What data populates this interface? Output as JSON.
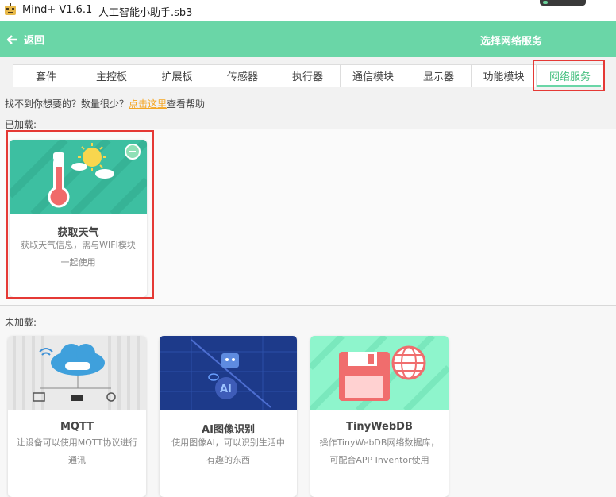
{
  "titlebar": {
    "app_name": "Mind+ V1.6.1",
    "file_name": "人工智能小助手.sb3"
  },
  "header": {
    "back_label": "返回",
    "title": "选择网络服务"
  },
  "tabs": [
    {
      "label": "套件",
      "active": false
    },
    {
      "label": "主控板",
      "active": false
    },
    {
      "label": "扩展板",
      "active": false
    },
    {
      "label": "传感器",
      "active": false
    },
    {
      "label": "执行器",
      "active": false
    },
    {
      "label": "通信模块",
      "active": false
    },
    {
      "label": "显示器",
      "active": false
    },
    {
      "label": "功能模块",
      "active": false
    },
    {
      "label": "网络服务",
      "active": true
    }
  ],
  "help": {
    "prefix": "找不到你想要的？数量很少？",
    "link": "点击这里",
    "suffix": "查看帮助"
  },
  "sections": {
    "loaded": "已加载:",
    "unloaded": "未加载:"
  },
  "loaded_cards": [
    {
      "title": "获取天气",
      "desc": "获取天气信息，需与WIFI模块一起使用",
      "icon": "thermometer-sun-icon"
    }
  ],
  "unloaded_cards": [
    {
      "title": "MQTT",
      "desc": "让设备可以使用MQTT协议进行通讯",
      "icon": "mqtt-cloud-icon"
    },
    {
      "title": "AI图像识别",
      "desc": "使用图像AI，可以识别生活中有趣的东西",
      "icon": "ai-robot-icon"
    },
    {
      "title": "TinyWebDB",
      "desc": "操作TinyWebDB网络数据库，可配合APP Inventor使用",
      "icon": "floppy-globe-icon"
    }
  ],
  "colors": {
    "header_green": "#6ad6a7",
    "active_tab": "#48c081",
    "highlight_red": "#e53935",
    "link_orange": "#f5a623"
  }
}
